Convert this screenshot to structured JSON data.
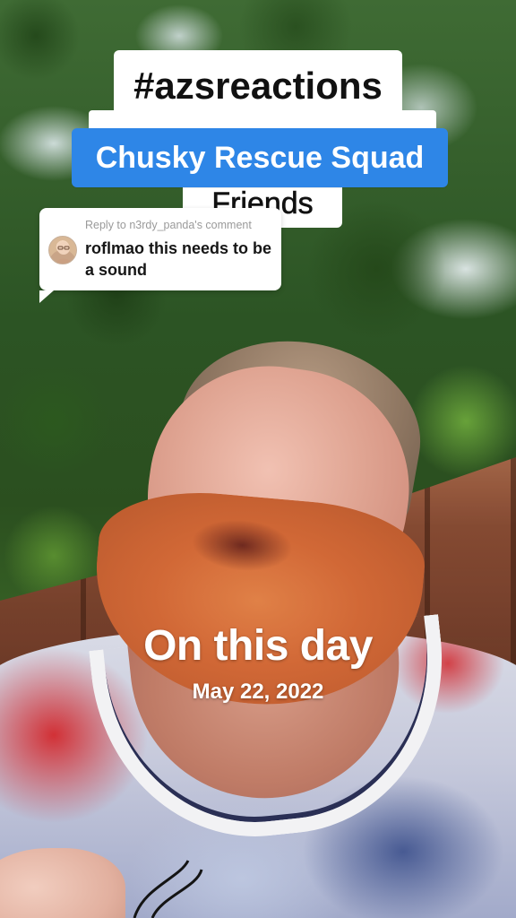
{
  "overlays": {
    "hashtag": "#azsreactions",
    "squad_banner": "Chusky Rescue Squad",
    "friends_label": "Friends",
    "squad_banner_color": "#2e86e7"
  },
  "reply": {
    "label": "Reply to n3rdy_panda's comment",
    "text": "roflmao this needs to be a sound",
    "avatar_icon": "user-avatar"
  },
  "memory": {
    "title": "On this day",
    "date": "May 22, 2022"
  }
}
